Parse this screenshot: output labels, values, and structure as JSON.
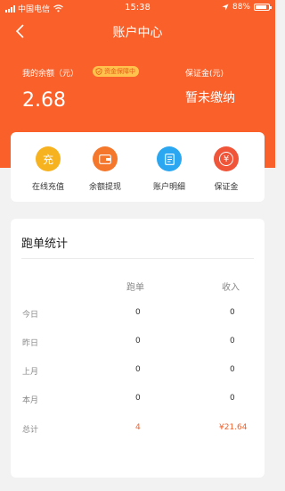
{
  "status_bar": {
    "carrier": "中国电信",
    "time": "15:38",
    "battery": "88%",
    "battery_level": 0.88
  },
  "nav": {
    "title": "账户中心"
  },
  "balance": {
    "label": "我的余额（元）",
    "tag": "资金保障中",
    "amount": "2.68",
    "deposit_label": "保证金(元)",
    "deposit_status": "暂未缴纳"
  },
  "actions": [
    {
      "label": "在线充值",
      "icon_char": "充",
      "icon": "recharge-icon",
      "color": "#f6b21f"
    },
    {
      "label": "余额提现",
      "icon": "wallet-icon",
      "color": "#f4772c"
    },
    {
      "label": "账户明细",
      "icon": "document-icon",
      "color": "#2aa7f0"
    },
    {
      "label": "保证金",
      "icon_char": "¥",
      "icon": "yuan-icon",
      "color": "#f0553a"
    }
  ],
  "stats": {
    "title": "跑单统计",
    "headers": {
      "orders": "跑单",
      "income": "收入"
    },
    "rows": [
      {
        "label": "今日",
        "orders": "0",
        "income": "0"
      },
      {
        "label": "昨日",
        "orders": "0",
        "income": "0"
      },
      {
        "label": "上月",
        "orders": "0",
        "income": "0"
      },
      {
        "label": "本月",
        "orders": "0",
        "income": "0"
      },
      {
        "label": "总计",
        "orders": "4",
        "income": "¥21.64"
      }
    ]
  }
}
